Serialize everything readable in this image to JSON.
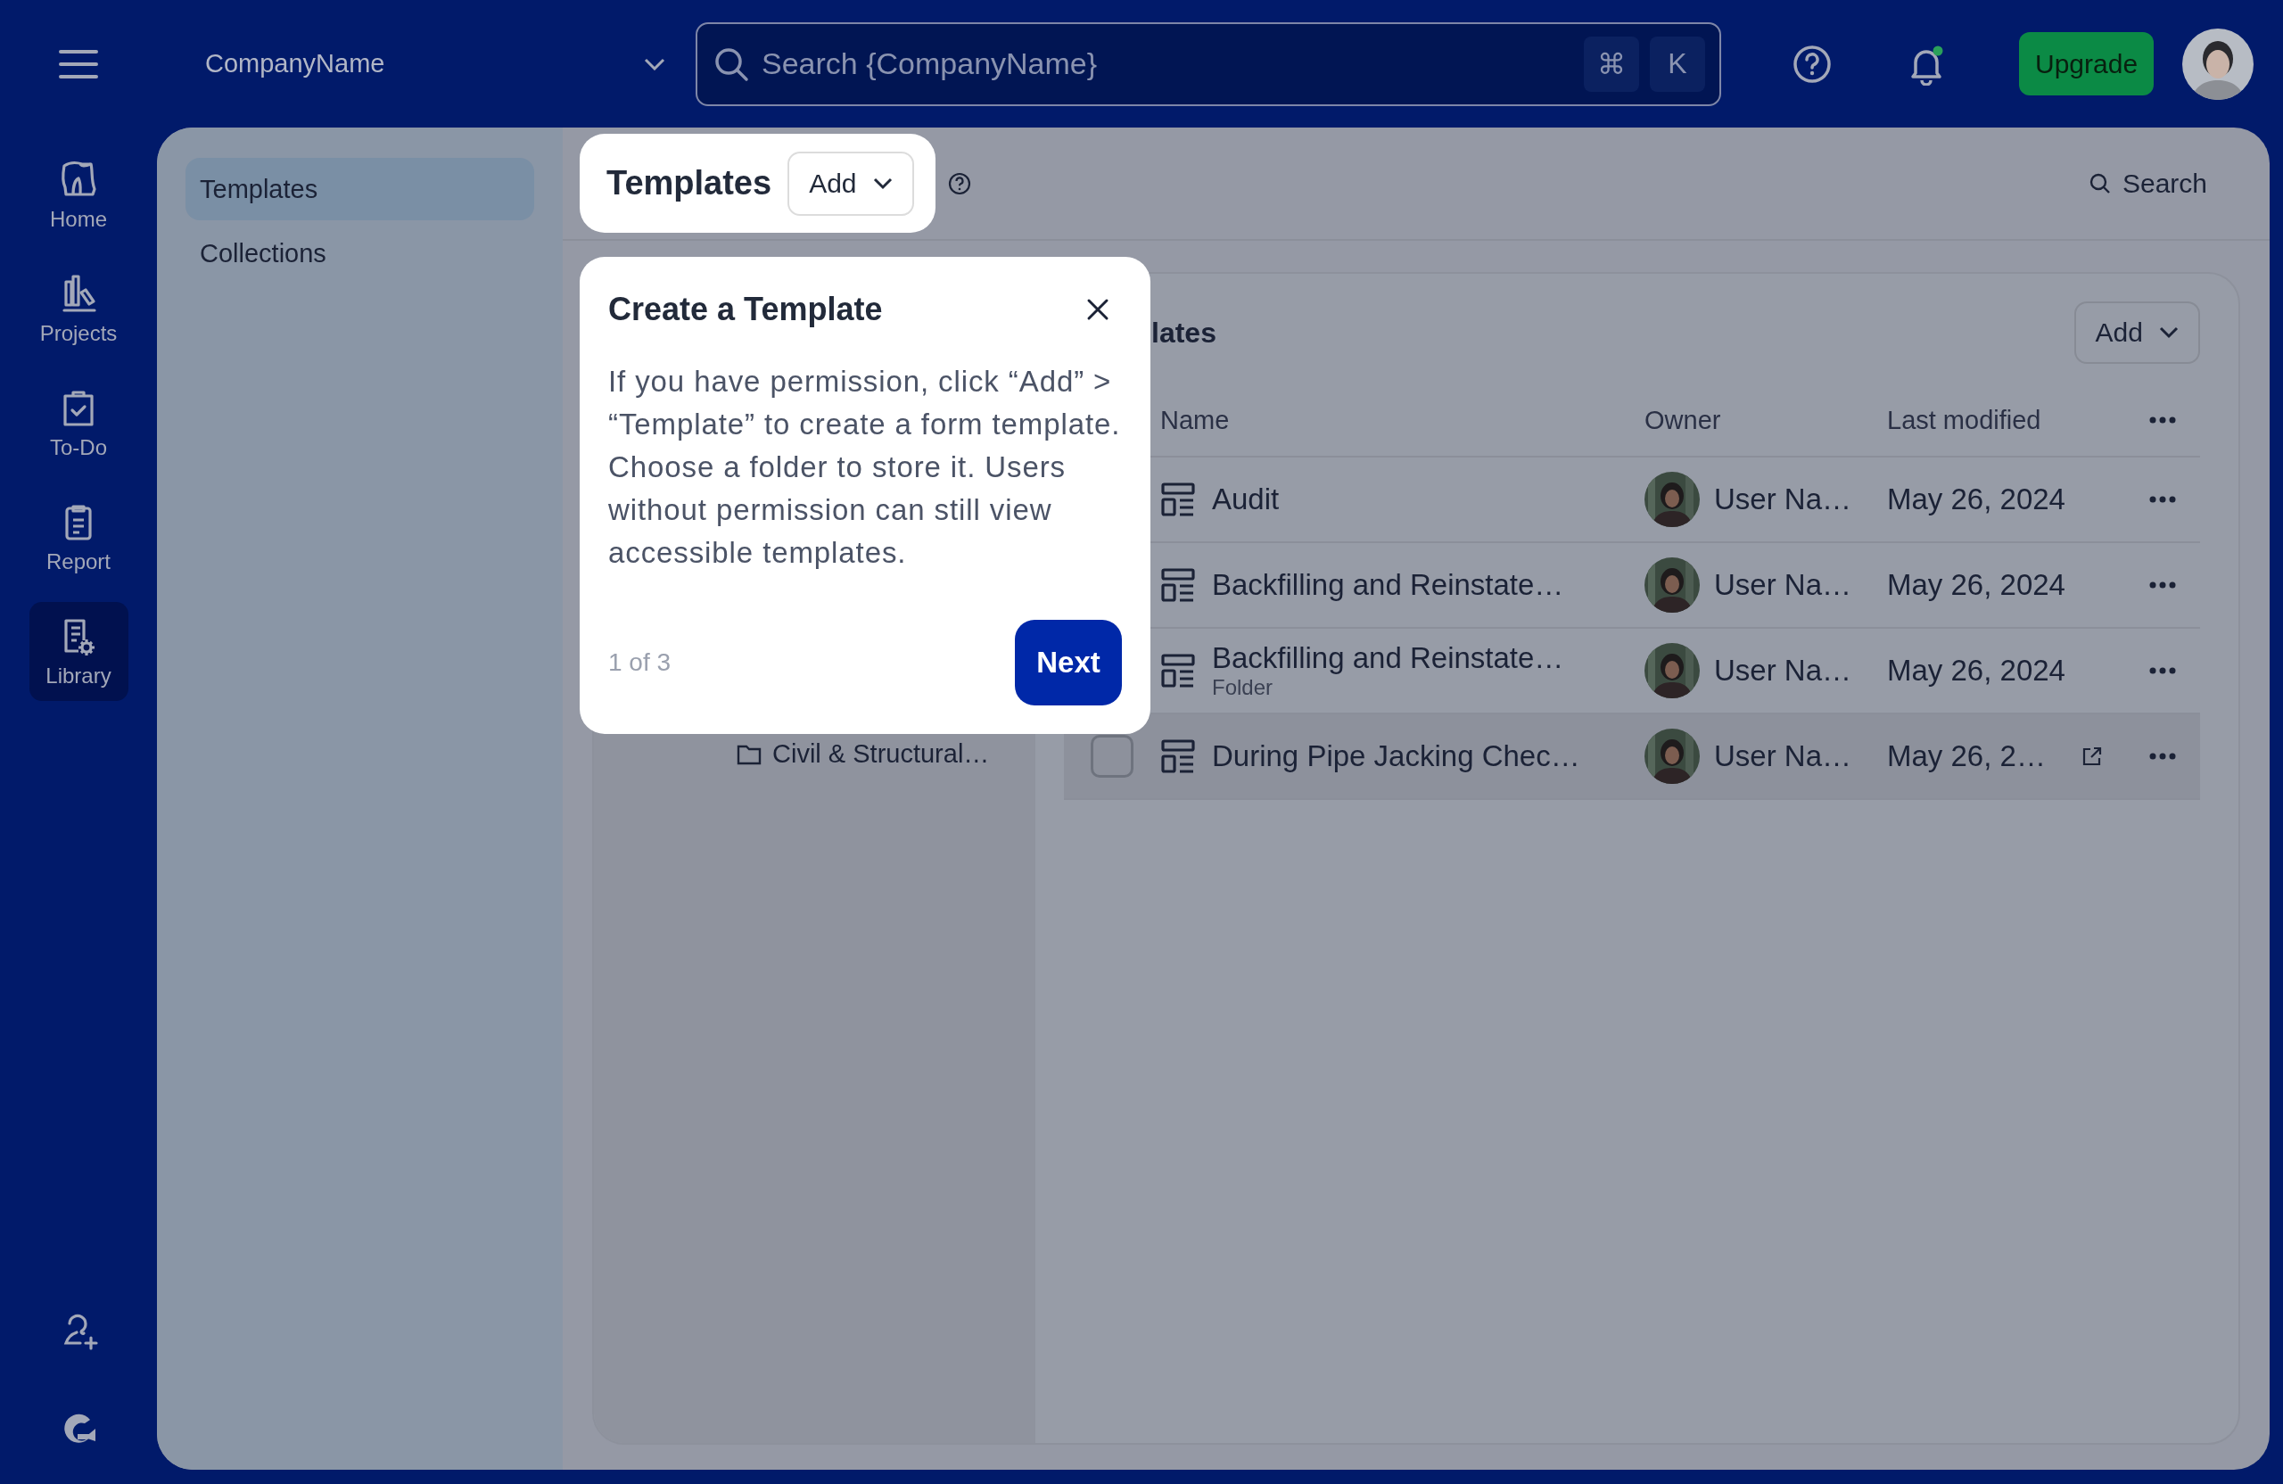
{
  "top_bar": {
    "company": "CompanyName",
    "search": {
      "placeholder": "Search {CompanyName}"
    },
    "shortcut_keys": [
      "⌘",
      "K"
    ],
    "notifications_unread": true,
    "upgrade_button": "Upgrade"
  },
  "nav_rail": {
    "items": [
      {
        "label": "Home",
        "kind": "home",
        "selected": false
      },
      {
        "label": "Projects",
        "kind": "projects",
        "selected": false
      },
      {
        "label": "To-Do",
        "kind": "todo",
        "selected": false
      },
      {
        "label": "Report",
        "kind": "report",
        "selected": false
      },
      {
        "label": "Library",
        "kind": "library",
        "selected": true
      }
    ],
    "bottom": [
      {
        "kind": "invite"
      },
      {
        "kind": "logo"
      }
    ]
  },
  "subnav": [
    {
      "label": "Templates",
      "selected": true
    },
    {
      "label": "Collections",
      "selected": false
    }
  ],
  "page_header": {
    "title": "Templates",
    "add_button": "Add",
    "search_button": "Search"
  },
  "folder_tree": [
    {
      "label": "Civil & Structural…"
    }
  ],
  "table": {
    "title": "lates",
    "add_button": "Add",
    "columns": [
      "Name",
      "Owner",
      "Last modified"
    ],
    "rows": [
      {
        "name": "Audit",
        "owner": "User Na…",
        "modified": "May 26, 2024",
        "hovered": false
      },
      {
        "name": "Backfilling and Reinstate…",
        "owner": "User Na…",
        "modified": "May 26, 2024",
        "hovered": false
      },
      {
        "name": "Backfilling and Reinstate…",
        "subtitle": "Folder",
        "owner": "User Na…",
        "modified": "May 26, 2024",
        "hovered": false
      },
      {
        "name": "During Pipe Jacking Chec…",
        "owner": "User Na…",
        "modified": "May 26, 2…",
        "hovered": true
      }
    ]
  },
  "tour": {
    "title": "Create a Template",
    "body": "If you have permission, click “Add” > “Template” to create a form template. Choose a folder to store it. Users without permission can still view accessible templates.",
    "step": "1 of 3",
    "next_button": "Next"
  }
}
